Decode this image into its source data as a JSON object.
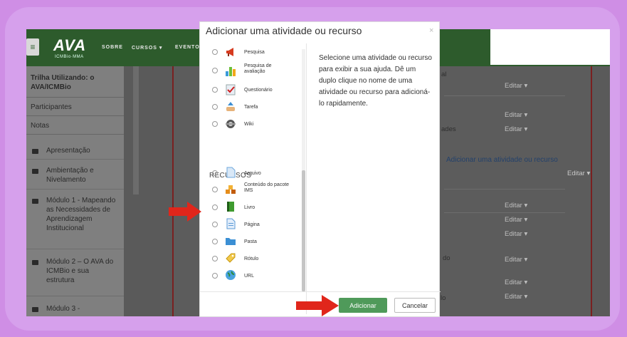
{
  "app": {
    "logo": "AVA",
    "logo_sub": "ICMBio·MMA",
    "nav": [
      "SOBRE",
      "CURSOS ▾",
      "EVENTO"
    ]
  },
  "sidebar": {
    "items": [
      {
        "label": "Trilha Utilizando: o AVA/ICMBio"
      },
      {
        "label": "Participantes"
      },
      {
        "label": "Notas"
      }
    ],
    "modules": [
      {
        "label": "Apresentação"
      },
      {
        "label": "Ambientação e Nivelamento"
      },
      {
        "label": "Módulo 1 - Mapeando as Necessidades de Aprendizagem Institucional"
      },
      {
        "label": "Módulo 2 – O AVA do ICMBio e sua estrutura"
      },
      {
        "label": "Módulo 3 -"
      }
    ]
  },
  "background": {
    "edit_label": "Editar ▾",
    "fragments": [
      "al",
      "ades",
      "do",
      "lo"
    ],
    "add_link": "Adicionar uma atividade ou recurso",
    "edit_right": "Editar ▾"
  },
  "modal": {
    "title": "Adicionar uma atividade ou recurso",
    "close": "×",
    "activities": [
      {
        "label": "Pesquisa",
        "icon": "megaphone-icon"
      },
      {
        "label": "Pesquisa de avaliação",
        "icon": "bar-chart-icon"
      },
      {
        "label": "Questionário",
        "icon": "checklist-icon"
      },
      {
        "label": "Tarefa",
        "icon": "hand-upload-icon"
      },
      {
        "label": "Wiki",
        "icon": "wiki-icon"
      }
    ],
    "section_label": "RECURSOS",
    "resources": [
      {
        "label": "Arquivo",
        "icon": "file-icon"
      },
      {
        "label": "Conteúdo do pacote IMS",
        "icon": "package-icon"
      },
      {
        "label": "Livro",
        "icon": "book-icon"
      },
      {
        "label": "Página",
        "icon": "page-icon"
      },
      {
        "label": "Pasta",
        "icon": "folder-icon"
      },
      {
        "label": "Rótulo",
        "icon": "tag-icon"
      },
      {
        "label": "URL",
        "icon": "globe-icon"
      }
    ],
    "help_text": "Selecione uma atividade ou recurso para exibir a sua ajuda. Dê um duplo clique no nome de uma atividade ou recurso para adicioná-lo rapidamente.",
    "add_button": "Adicionar",
    "cancel_button": "Cancelar"
  },
  "colors": {
    "frame": "#cf8ee5",
    "nav": "#2d5b2c",
    "add_button": "#4f9a5a",
    "arrow": "#e0261b"
  }
}
